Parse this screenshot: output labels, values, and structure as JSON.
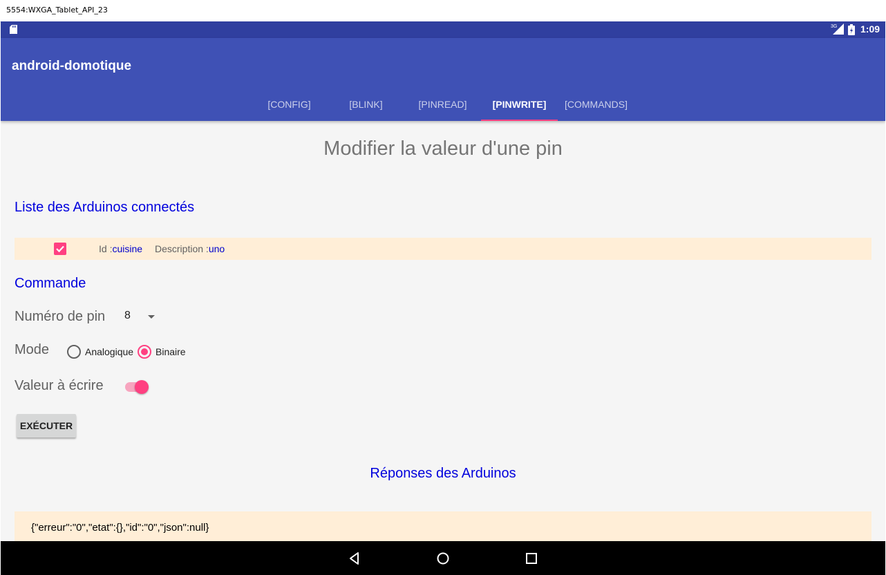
{
  "window": {
    "title": "5554:WXGA_Tablet_API_23"
  },
  "statusbar": {
    "time": "1:09",
    "network": "3G"
  },
  "appbar": {
    "title": "android-domotique"
  },
  "tabs": [
    {
      "label": "[CONFIG]"
    },
    {
      "label": "[BLINK]"
    },
    {
      "label": "[PINREAD]"
    },
    {
      "label": "[PINWRITE]",
      "active": true
    },
    {
      "label": "[COMMANDS]"
    }
  ],
  "page": {
    "title": "Modifier la valeur d'une pin"
  },
  "arduinos": {
    "heading": "Liste des Arduinos connectés",
    "items": [
      {
        "checked": true,
        "id_label": "Id :",
        "id_value": "cuisine",
        "desc_label": "Description :",
        "desc_value": "uno"
      }
    ]
  },
  "command": {
    "heading": "Commande",
    "pin_label": "Numéro de pin",
    "pin_value": "8",
    "mode_label": "Mode",
    "mode_options": [
      {
        "label": "Analogique",
        "selected": false
      },
      {
        "label": "Binaire",
        "selected": true
      }
    ],
    "value_label": "Valeur à écrire",
    "value_on": true,
    "execute_label": "EXÉCUTER"
  },
  "responses": {
    "heading": "Réponses des Arduinos",
    "items": [
      "{\"erreur\":\"0\",\"etat\":{},\"id\":\"0\",\"json\":null}"
    ]
  },
  "colors": {
    "primary": "#3f51b5",
    "primary_dark": "#303f9f",
    "accent": "#ff4081",
    "row_bg": "#ffeed7",
    "heading_blue": "#0000dd"
  },
  "icons": {
    "sd": "sd-card-icon",
    "signal": "signal-icon",
    "battery": "battery-icon",
    "back": "back-icon",
    "home": "home-icon",
    "recents": "recents-icon"
  }
}
